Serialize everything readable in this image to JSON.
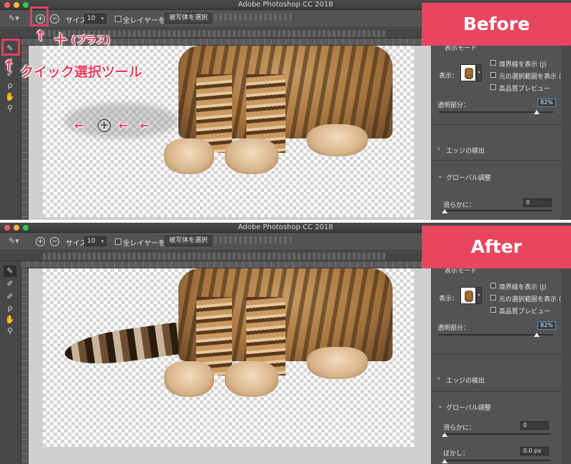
{
  "app": {
    "title": "Adobe Photoshop CC 2018"
  },
  "options": {
    "size_label": "サイズ：",
    "size_value": "10",
    "all_layers_label": "全レイヤーを対象",
    "select_subject_label": "被写体を選択"
  },
  "properties": {
    "view_mode_header": "表示モード",
    "view_label": "表示：",
    "show_edges": "境界線を表示 (J)",
    "show_original": "元の選択範囲を表示 (P)",
    "high_quality": "高品質プレビュー",
    "opacity_label": "透明部分：",
    "opacity_value": "82%",
    "edge_detection": "エッジの検出",
    "global_refinements": "グローバル調整",
    "smooth_label": "滑らかに：",
    "smooth_value": "0",
    "feather_label": "ぼかし：",
    "feather_value": "0.0 px"
  },
  "annotations": {
    "before_badge": "Before",
    "after_badge": "After",
    "plus_label": "(プラス)",
    "plus_symbol": "＋",
    "quick_select_label": "クイック選択ツール",
    "arrow_up": "↑",
    "arrows_left": "← ",
    "cursor_plus": "+"
  },
  "icons": [
    "quick-selection-icon",
    "brush-icon",
    "lasso-icon",
    "hand-icon",
    "zoom-icon"
  ],
  "colors": {
    "accent": "#e8465f",
    "highlight": "#e2415f",
    "ui_bg": "#535353"
  }
}
